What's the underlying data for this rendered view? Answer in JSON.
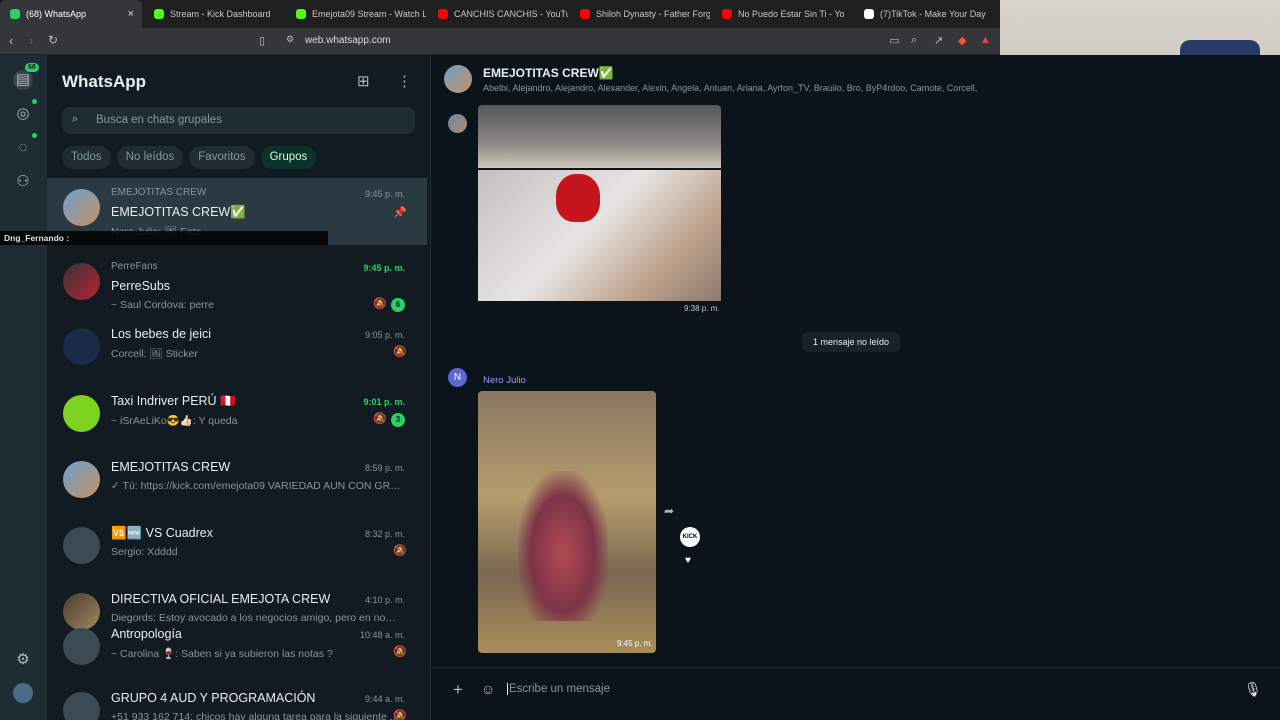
{
  "browser": {
    "tabs": [
      {
        "label": "(68) WhatsApp",
        "icon": "whatsapp-icon",
        "color": "#25d366"
      },
      {
        "label": "Stream - Kick Dashboard",
        "icon": "kick-icon",
        "color": "#53fc18"
      },
      {
        "label": "Emejota09 Stream - Watch Live",
        "icon": "kick-icon",
        "color": "#53fc18"
      },
      {
        "label": "CANCHIS CANCHIS - YouTube",
        "icon": "youtube-icon",
        "color": "#ff0000"
      },
      {
        "label": "Shiloh Dynasty - Father Forgive",
        "icon": "youtube-icon",
        "color": "#ff0000"
      },
      {
        "label": "No Puedo Estar Sin Ti - Yo",
        "icon": "youtube-icon",
        "color": "#ff0000"
      },
      {
        "label": "(7)TikTok - Make Your Day",
        "icon": "tiktok-icon",
        "color": "#ffffff"
      }
    ],
    "url": "web.whatsapp.com"
  },
  "rail": {
    "badge": "68"
  },
  "sidebar": {
    "title": "WhatsApp",
    "search_placeholder": "Busca en chats grupales",
    "filters": [
      "Todos",
      "No leídos",
      "Favoritos",
      "Grupos"
    ],
    "overlay_text": "Dng_Fernando :",
    "chats": [
      {
        "sub": "EMEJOTITAS CREW",
        "name": "EMEJOTITAS CREW✅",
        "time": "9:45 p. m.",
        "msg": "Nero Julio: 🖼 Foto",
        "pinned": true
      },
      {
        "sub": "PerreFans",
        "name": "PerreSubs",
        "time": "9:45 p. m.",
        "msg": "~ Saul Cordova: perre",
        "badge": "6",
        "muted": true,
        "unread": true
      },
      {
        "name": "Los bebes de jeici",
        "time": "9:05 p. m.",
        "msg": "Corcell: 🖼 Sticker",
        "muted": true
      },
      {
        "name": "Taxi Indriver PERÚ 🇵🇪",
        "time": "9:01 p. m.",
        "msg": "~ iSrAeLiKo😎👍🏻: Y queda",
        "badge": "3",
        "muted": true,
        "unread": true
      },
      {
        "name": "EMEJOTITAS CREW",
        "time": "8:59 p. m.",
        "msg": "✓ Tú: https://kick.com/emejota09 VARIEDAD AUN CON GRIP..."
      },
      {
        "name": "🆚🆕 VS Cuadrex",
        "time": "8:32 p. m.",
        "msg": "Sergio: Xdddd",
        "muted": true
      },
      {
        "name": "DIRECTIVA OFICIAL EMEJOTA CREW",
        "time": "4:10 p. m.",
        "msg": "Diegords: Estoy avocado a los negocios amigo, pero en novie..."
      },
      {
        "name": "Antropología",
        "time": "10:48 a. m.",
        "msg": "~ Carolina 🍷: Saben si ya subieron las notas ?",
        "muted": true
      },
      {
        "name": "GRUPO 4 AUD Y PROGRAMACIÓN",
        "time": "9:44 a. m.",
        "msg": "+51 933 162 714: chicos hay alguna tarea para la siguiente ...",
        "muted": true
      }
    ]
  },
  "conversation": {
    "title": "EMEJOTITAS CREW✅",
    "members": "Abelbi, Alejandro, Alejandro, Alexander, Alexin, Angela, Antuan, Ariana, Ayrton_TV, Braulio, Bro, ByP4rdoo, Camote, Corcell,",
    "time_first": "9:38 p. m.",
    "unread_divider": "1 mensaje no leído",
    "sender": "Nero Julio",
    "sender_initial": "N",
    "video_badge": "KICK",
    "time_second": "9:45 p. m.",
    "composer_placeholder": "Escribe un mensaje"
  }
}
